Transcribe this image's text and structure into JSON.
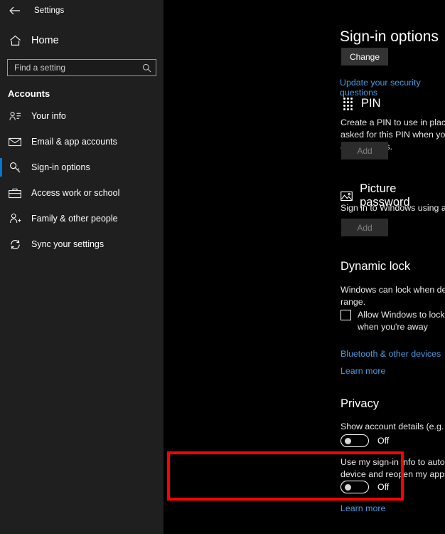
{
  "window": {
    "back_label": "back-arrow",
    "title": "Settings"
  },
  "sidebar": {
    "home_label": "Home",
    "search": {
      "placeholder": "Find a setting",
      "value": ""
    },
    "group_title": "Accounts",
    "items": [
      {
        "label": "Your info",
        "icon": "user-info-icon",
        "selected": false
      },
      {
        "label": "Email & app accounts",
        "icon": "envelope-icon",
        "selected": false
      },
      {
        "label": "Sign-in options",
        "icon": "key-icon",
        "selected": true
      },
      {
        "label": "Access work or school",
        "icon": "briefcase-icon",
        "selected": false
      },
      {
        "label": "Family & other people",
        "icon": "user-add-icon",
        "selected": false
      },
      {
        "label": "Sync your settings",
        "icon": "sync-icon",
        "selected": false
      }
    ]
  },
  "main": {
    "page_title": "Sign-in options",
    "change_button": "Change",
    "security_questions_link": "Update your security questions",
    "pin": {
      "heading": "PIN",
      "icon": "keypad-icon",
      "description": "Create a PIN to use in place of passwords. You'll be asked for this PIN when you sign in to Windows, apps and services.",
      "button": "Add",
      "button_disabled": true
    },
    "picture_password": {
      "heading": "Picture password",
      "icon": "picture-icon",
      "description": "Sign in to Windows using a favourite photo.",
      "button": "Add",
      "button_disabled": true
    },
    "dynamic_lock": {
      "heading": "Dynamic lock",
      "description": "Windows can lock when devices paired to your PC go out of range.",
      "checkbox_label": "Allow Windows to lock your device automatically when you're away",
      "checkbox_checked": false,
      "bluetooth_link": "Bluetooth & other devices",
      "learn_more_link": "Learn more"
    },
    "privacy": {
      "heading": "Privacy",
      "setting_one": {
        "label": "Show account details (e.g. email address) on sign-in screen",
        "state": "Off"
      },
      "setting_two": {
        "label": "Use my sign-in info to automatically finish setting up my device and reopen my apps after an update or restart.",
        "state": "Off"
      },
      "learn_more_link": "Learn more"
    }
  },
  "annotation": {
    "highlight_color": "#ff0000"
  }
}
